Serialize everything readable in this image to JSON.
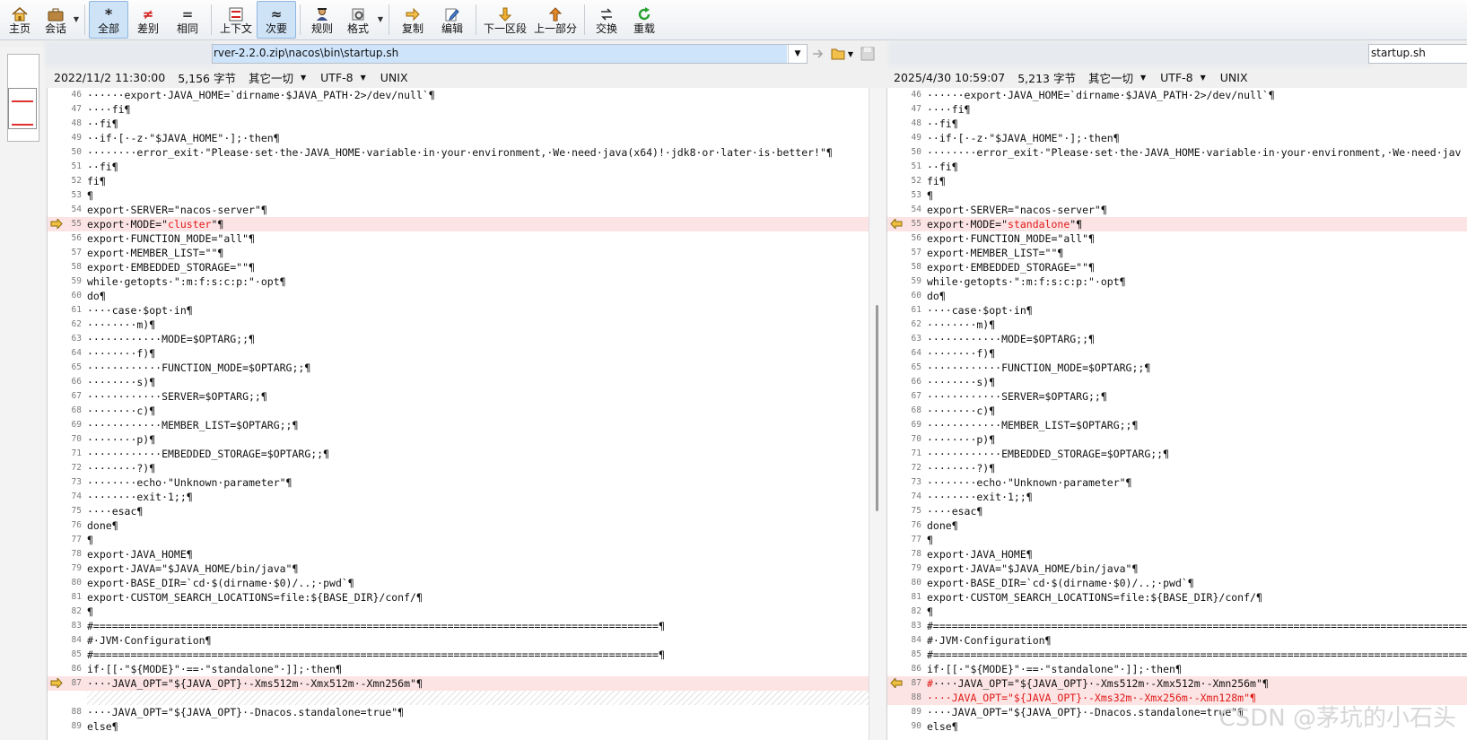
{
  "toolbar": {
    "buttons": [
      {
        "label": "主页",
        "icon": "home-icon"
      },
      {
        "label": "会话",
        "icon": "briefcase-icon"
      },
      {
        "label": "全部",
        "icon": "asterisk-icon"
      },
      {
        "label": "差别",
        "icon": "not-equal-icon"
      },
      {
        "label": "相同",
        "icon": "equal-icon"
      },
      {
        "label": "上下文",
        "icon": "context-icon"
      },
      {
        "label": "次要",
        "icon": "approx-icon"
      },
      {
        "label": "规则",
        "icon": "rules-person-icon"
      },
      {
        "label": "格式",
        "icon": "format-gear-icon"
      },
      {
        "label": "复制",
        "icon": "copy-arrow-icon"
      },
      {
        "label": "编辑",
        "icon": "edit-pencil-icon"
      },
      {
        "label": "下一区段",
        "icon": "down-arrow-icon"
      },
      {
        "label": "上一部分",
        "icon": "up-arrow-icon"
      },
      {
        "label": "交换",
        "icon": "swap-icon"
      },
      {
        "label": "重载",
        "icon": "reload-icon"
      }
    ]
  },
  "left": {
    "path": "rver-2.2.0.zip\\nacos\\bin\\startup.sh",
    "timestamp": "2022/11/2 11:30:00",
    "size": "5,156 字节",
    "format": "其它一切",
    "encoding": "UTF-8",
    "eol": "UNIX"
  },
  "right": {
    "path": "startup.sh",
    "timestamp": "2025/4/30 10:59:07",
    "size": "5,213 字节",
    "format": "其它一切",
    "encoding": "UTF-8",
    "eol": "UNIX"
  },
  "watermark": "CSDN @茅坑的小石头",
  "colors": {
    "diff_bg": "#fde4e4",
    "diff_text": "#e01919",
    "selected_button": "#cfe3f7"
  },
  "left_lines": [
    {
      "num": "46",
      "text": "······export·JAVA_HOME=`dirname·$JAVA_PATH·2>/dev/null`¶"
    },
    {
      "num": "47",
      "text": "····fi¶"
    },
    {
      "num": "48",
      "text": "··fi¶"
    },
    {
      "num": "49",
      "text": "··if·[·-z·\"$JAVA_HOME\"·];·then¶"
    },
    {
      "num": "50",
      "text": "········error_exit·\"Please·set·the·JAVA_HOME·variable·in·your·environment,·We·need·java(x64)!·jdk8·or·later·is·better!\"¶"
    },
    {
      "num": "51",
      "text": "··fi¶"
    },
    {
      "num": "52",
      "text": "fi¶"
    },
    {
      "num": "53",
      "text": "¶"
    },
    {
      "num": "54",
      "text": "export·SERVER=\"nacos-server\"¶"
    },
    {
      "num": "55",
      "pre": "export·MODE=\"",
      "red": "cluster",
      "post": "\"¶",
      "diff": true,
      "mark": true
    },
    {
      "num": "56",
      "text": "export·FUNCTION_MODE=\"all\"¶"
    },
    {
      "num": "57",
      "text": "export·MEMBER_LIST=\"\"¶"
    },
    {
      "num": "58",
      "text": "export·EMBEDDED_STORAGE=\"\"¶"
    },
    {
      "num": "59",
      "text": "while·getopts·\":m:f:s:c:p:\"·opt¶"
    },
    {
      "num": "60",
      "text": "do¶"
    },
    {
      "num": "61",
      "text": "····case·$opt·in¶"
    },
    {
      "num": "62",
      "text": "········m)¶"
    },
    {
      "num": "63",
      "text": "············MODE=$OPTARG;;¶"
    },
    {
      "num": "64",
      "text": "········f)¶"
    },
    {
      "num": "65",
      "text": "············FUNCTION_MODE=$OPTARG;;¶"
    },
    {
      "num": "66",
      "text": "········s)¶"
    },
    {
      "num": "67",
      "text": "············SERVER=$OPTARG;;¶"
    },
    {
      "num": "68",
      "text": "········c)¶"
    },
    {
      "num": "69",
      "text": "············MEMBER_LIST=$OPTARG;;¶"
    },
    {
      "num": "70",
      "text": "········p)¶"
    },
    {
      "num": "71",
      "text": "············EMBEDDED_STORAGE=$OPTARG;;¶"
    },
    {
      "num": "72",
      "text": "········?)¶"
    },
    {
      "num": "73",
      "text": "········echo·\"Unknown·parameter\"¶"
    },
    {
      "num": "74",
      "text": "········exit·1;;¶"
    },
    {
      "num": "75",
      "text": "····esac¶"
    },
    {
      "num": "76",
      "text": "done¶"
    },
    {
      "num": "77",
      "text": "¶"
    },
    {
      "num": "78",
      "text": "export·JAVA_HOME¶"
    },
    {
      "num": "79",
      "text": "export·JAVA=\"$JAVA_HOME/bin/java\"¶"
    },
    {
      "num": "80",
      "text": "export·BASE_DIR=`cd·$(dirname·$0)/..;·pwd`¶"
    },
    {
      "num": "81",
      "text": "export·CUSTOM_SEARCH_LOCATIONS=file:${BASE_DIR}/conf/¶"
    },
    {
      "num": "82",
      "text": "¶"
    },
    {
      "num": "83",
      "text": "#===========================================================================================¶"
    },
    {
      "num": "84",
      "text": "#·JVM·Configuration¶"
    },
    {
      "num": "85",
      "text": "#===========================================================================================¶"
    },
    {
      "num": "86",
      "text": "if·[[·\"${MODE}\"·==·\"standalone\"·]];·then¶"
    },
    {
      "num": "87",
      "text": "····JAVA_OPT=\"${JAVA_OPT}·-Xms512m·-Xmx512m·-Xmn256m\"¶",
      "diff": true,
      "mark": true
    },
    {
      "num": "",
      "text": "",
      "gap": true
    },
    {
      "num": "88",
      "text": "····JAVA_OPT=\"${JAVA_OPT}·-Dnacos.standalone=true\"¶"
    },
    {
      "num": "89",
      "text": "else¶"
    }
  ],
  "right_lines": [
    {
      "num": "46",
      "text": "······export·JAVA_HOME=`dirname·$JAVA_PATH·2>/dev/null`¶"
    },
    {
      "num": "47",
      "text": "····fi¶"
    },
    {
      "num": "48",
      "text": "··fi¶"
    },
    {
      "num": "49",
      "text": "··if·[·-z·\"$JAVA_HOME\"·];·then¶"
    },
    {
      "num": "50",
      "text": "········error_exit·\"Please·set·the·JAVA_HOME·variable·in·your·environment,·We·need·jav"
    },
    {
      "num": "51",
      "text": "··fi¶"
    },
    {
      "num": "52",
      "text": "fi¶"
    },
    {
      "num": "53",
      "text": "¶"
    },
    {
      "num": "54",
      "text": "export·SERVER=\"nacos-server\"¶"
    },
    {
      "num": "55",
      "pre": "export·MODE=\"",
      "red": "standalone",
      "post": "\"¶",
      "diff": true,
      "mark": true
    },
    {
      "num": "56",
      "text": "export·FUNCTION_MODE=\"all\"¶"
    },
    {
      "num": "57",
      "text": "export·MEMBER_LIST=\"\"¶"
    },
    {
      "num": "58",
      "text": "export·EMBEDDED_STORAGE=\"\"¶"
    },
    {
      "num": "59",
      "text": "while·getopts·\":m:f:s:c:p:\"·opt¶"
    },
    {
      "num": "60",
      "text": "do¶"
    },
    {
      "num": "61",
      "text": "····case·$opt·in¶"
    },
    {
      "num": "62",
      "text": "········m)¶"
    },
    {
      "num": "63",
      "text": "············MODE=$OPTARG;;¶"
    },
    {
      "num": "64",
      "text": "········f)¶"
    },
    {
      "num": "65",
      "text": "············FUNCTION_MODE=$OPTARG;;¶"
    },
    {
      "num": "66",
      "text": "········s)¶"
    },
    {
      "num": "67",
      "text": "············SERVER=$OPTARG;;¶"
    },
    {
      "num": "68",
      "text": "········c)¶"
    },
    {
      "num": "69",
      "text": "············MEMBER_LIST=$OPTARG;;¶"
    },
    {
      "num": "70",
      "text": "········p)¶"
    },
    {
      "num": "71",
      "text": "············EMBEDDED_STORAGE=$OPTARG;;¶"
    },
    {
      "num": "72",
      "text": "········?)¶"
    },
    {
      "num": "73",
      "text": "········echo·\"Unknown·parameter\"¶"
    },
    {
      "num": "74",
      "text": "········exit·1;;¶"
    },
    {
      "num": "75",
      "text": "····esac¶"
    },
    {
      "num": "76",
      "text": "done¶"
    },
    {
      "num": "77",
      "text": "¶"
    },
    {
      "num": "78",
      "text": "export·JAVA_HOME¶"
    },
    {
      "num": "79",
      "text": "export·JAVA=\"$JAVA_HOME/bin/java\"¶"
    },
    {
      "num": "80",
      "text": "export·BASE_DIR=`cd·$(dirname·$0)/..;·pwd`¶"
    },
    {
      "num": "81",
      "text": "export·CUSTOM_SEARCH_LOCATIONS=file:${BASE_DIR}/conf/¶"
    },
    {
      "num": "82",
      "text": "¶"
    },
    {
      "num": "83",
      "text": "#===========================================================================================¶"
    },
    {
      "num": "84",
      "text": "#·JVM·Configuration¶"
    },
    {
      "num": "85",
      "text": "#===========================================================================================¶"
    },
    {
      "num": "86",
      "text": "if·[[·\"${MODE}\"·==·\"standalone\"·]];·then¶"
    },
    {
      "num": "87",
      "pre": "",
      "red": "#",
      "post": "····JAVA_OPT=\"${JAVA_OPT}·-Xms512m·-Xmx512m·-Xmn256m\"¶",
      "diff": true,
      "mark": true
    },
    {
      "num": "88",
      "pre": "",
      "red": "····JAVA_OPT=\"${JAVA_OPT}·-Xms32m·-Xmx256m·-Xmn128m\"¶",
      "post": "",
      "diff": true
    },
    {
      "num": "89",
      "text": "····JAVA_OPT=\"${JAVA_OPT}·-Dnacos.standalone=true\"¶"
    },
    {
      "num": "90",
      "text": "else¶"
    }
  ]
}
